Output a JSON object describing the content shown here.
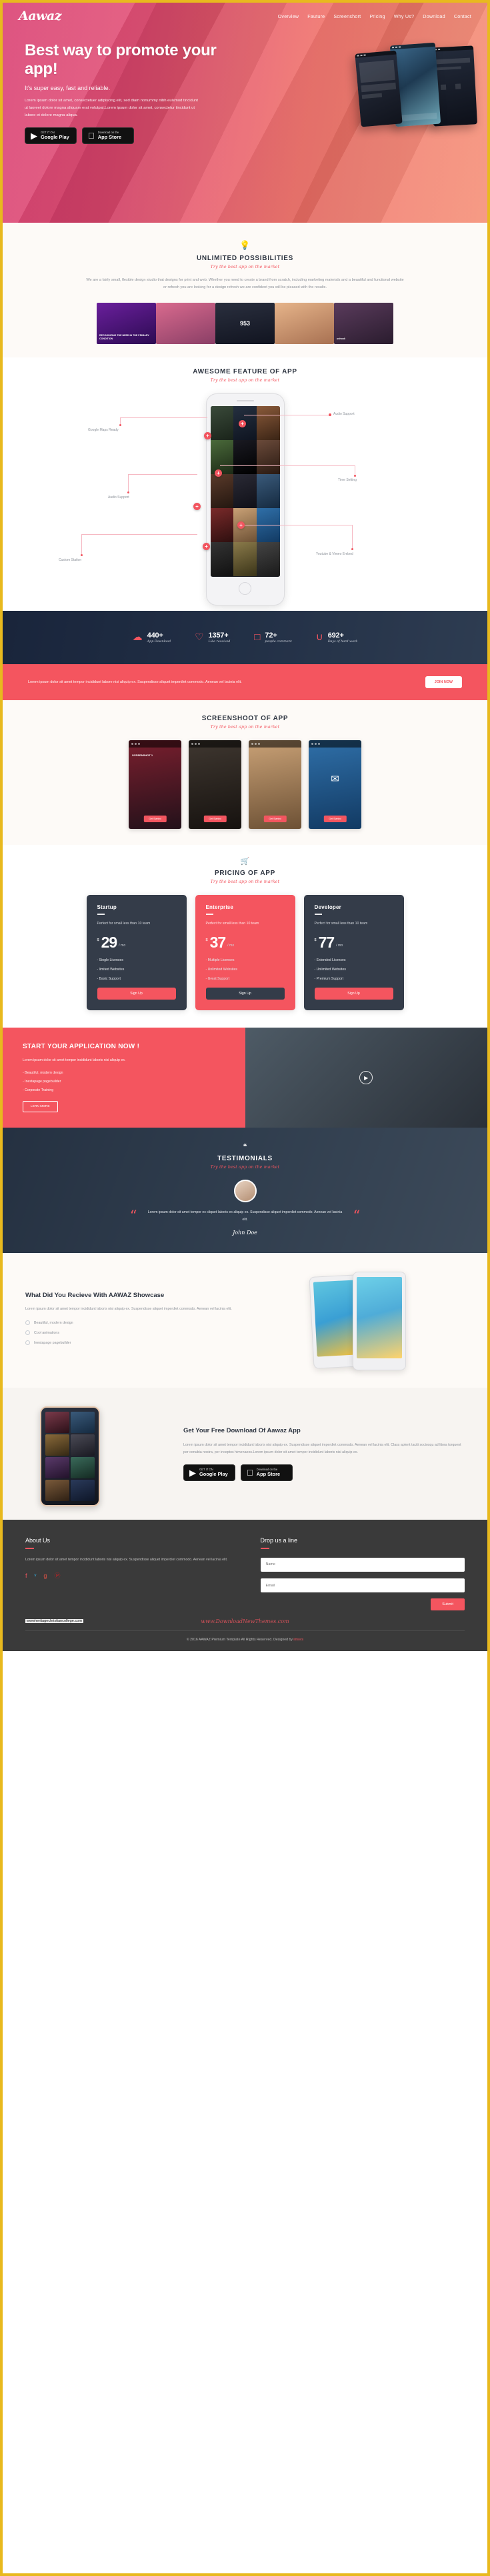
{
  "brand": {
    "logo": "Aawaz",
    "accent": "#f4555f",
    "dark": "#343c49",
    "border": "#e8b91e"
  },
  "nav": {
    "items": [
      {
        "label": "Overview"
      },
      {
        "label": "Fauture"
      },
      {
        "label": "Screenshort"
      },
      {
        "label": "Pricing"
      },
      {
        "label": "Why Us?"
      },
      {
        "label": "Download"
      },
      {
        "label": "Contact"
      }
    ]
  },
  "hero": {
    "heading": "Best way to promote your app!",
    "subheading": "It's super easy, fast and reliable.",
    "lead": "Lorem ipsum dolor sit amet, consectetuer adipiscing elit, sed diam nonummy nibh euismod tincidunt ut laoreet dolore magna aliquam erat volutpat.Lorem ipsum dolor sit amet, consectetur tincidunt ut labore et dolore magna aliqua.",
    "stores": [
      {
        "icon": "google-play-icon",
        "glyph": "▶",
        "small": "GET IT ON",
        "big": "Google Play"
      },
      {
        "icon": "apple-icon",
        "glyph": "",
        "small": "Download on the",
        "big": "App Store"
      }
    ]
  },
  "unlimited": {
    "icon": "lightbulb-icon",
    "glyph": "💡",
    "title": "UNLIMITED POSSIBILITIES",
    "subtitle": "Try the best app on the market",
    "body": "We are a fairly small, flexible design studio that designs for print and web. Whether you need to create a brand from scratch, including marketing materials and a beautiful and functional website or refresh you are looking for a design refresh we are confident you will be pleased with the results.",
    "showcase": [
      {
        "caption": "RECOGNIZING THE NEED IN THE PRIMARY CONDITION",
        "color1": "#6a1f9c",
        "color2": "#2c0b52"
      },
      {
        "caption": "",
        "color1": "#d96a8e",
        "color2": "#8a3f66"
      },
      {
        "caption": "953",
        "color1": "#2a2f3e",
        "color2": "#111420"
      },
      {
        "caption": "",
        "color1": "#e6b48a",
        "color2": "#a87152"
      },
      {
        "caption": "unhook",
        "color1": "#5a3b5c",
        "color2": "#2a1c2e"
      }
    ]
  },
  "feature": {
    "title": "AWESOME FEATURE OF APP",
    "subtitle": "Try the best app on the market",
    "labels_left": [
      {
        "label": "Google Maps Ready"
      },
      {
        "label": "Audio Support"
      },
      {
        "label": "Custom Station"
      }
    ],
    "labels_right": [
      {
        "label": "Audio Support"
      },
      {
        "label": "Time Setting"
      },
      {
        "label": "Youtube & Vimeo Embed"
      }
    ],
    "marker": "+"
  },
  "counters": [
    {
      "icon": "cloud-download-icon",
      "glyph": "☁",
      "number": "440+",
      "label": "App Download"
    },
    {
      "icon": "heart-icon",
      "glyph": "♡",
      "number": "1357+",
      "label": "Like received"
    },
    {
      "icon": "comment-icon",
      "glyph": "□",
      "number": "72+",
      "label": "people comment"
    },
    {
      "icon": "coffee-icon",
      "glyph": "∪",
      "number": "692+",
      "label": "Days of hard work"
    }
  ],
  "band": {
    "text": "Lorem ipsum dolor sit amet tempor incididunt labore nisi aliquip ex. Suspendisse aliquet imperdiet commodo. Aenean vel lacinia elit.",
    "button": "JOIN NOW"
  },
  "screenshot": {
    "title": "SCREENSHOOT OF APP",
    "subtitle": "Try the best app on the market",
    "items": [
      {
        "label": "SCREENSHOT 1",
        "button": "Get Started",
        "c1": "#7a1f2e",
        "c2": "#23111a"
      },
      {
        "label": "",
        "button": "Get Started",
        "c1": "#3f3730",
        "c2": "#16120f"
      },
      {
        "label": "",
        "button": "Get Started",
        "c1": "#c9a176",
        "c2": "#6d5135"
      },
      {
        "label": "",
        "button": "Get Started",
        "c1": "#2f6fa8",
        "c2": "#123a63"
      }
    ]
  },
  "pricing": {
    "icon": "cart-icon",
    "glyph": "🛒",
    "title": "PRICING OF APP",
    "subtitle": "Try the best app on the market",
    "plans": [
      {
        "name": "Startup",
        "desc": "Perfect for small less than 10 team",
        "currency": "$",
        "amount": "29",
        "period": "/ mo",
        "features": [
          "- Single Licenses",
          "- limited Websites",
          "- Basic Support"
        ],
        "cta": "Sign Up",
        "highlight": false
      },
      {
        "name": "Enterprise",
        "desc": "Perfect for small less than 10 team",
        "currency": "$",
        "amount": "37",
        "period": "/ mo",
        "features": [
          "- Multiple Licenses",
          "- Unlimited Websites",
          "- Great Support"
        ],
        "cta": "Sign Up",
        "highlight": true
      },
      {
        "name": "Developer",
        "desc": "Perfect for small less than 10 team",
        "currency": "$",
        "amount": "77",
        "period": "/ mo",
        "features": [
          "- Extended Licenses",
          "- Unlimited Websites",
          "- Premium Support"
        ],
        "cta": "Sign Up",
        "highlight": false
      }
    ]
  },
  "start": {
    "heading": "START YOUR APPLICATION NOW !",
    "text": "Lorem ipsum dolor sit amet tempor incididunt laboris nisi aliquip ex.",
    "features": [
      "- Beautiful, modern design",
      "- Inestapage pagebuilder",
      "- Corporate Training"
    ],
    "button": "LERN MORE",
    "play_icon": "play-icon"
  },
  "testimonials": {
    "icon": "quote-icon",
    "glyph": "❝",
    "title": "TESTIMONIALS",
    "subtitle": "Try the best app on the market",
    "quote": "Lorem ipsum dolor sit amet tempor ex cliquet laboris ex aliquip ex. Suspendisse aliquet imperdiet commodo. Aenean vel lacinia elit.",
    "author": "John Doe",
    "quote_mark": "“"
  },
  "receive": {
    "heading": "What Did You Recieve With AAWAZ Showcase",
    "text": "Lorem ipsum dolor sit amet tempor incididunt laboris nisi aliquip ex. Suspendisse aliquet imperdiet commodo. Aenean vel lacinia elit.",
    "features": [
      {
        "label": "Beautiful, modern design"
      },
      {
        "label": "Cool animations"
      },
      {
        "label": "Inestapage pagebuilder"
      }
    ]
  },
  "free_download": {
    "heading": "Get Your Free Download Of Aawaz App",
    "text": "Lorem ipsum dolor sit amet tempor incididunt laboris nisi aliquip ex. Suspendisse aliquet imperdiet commodo. Aenean vel lacinia elit. Class aptent taciti sociosqu ad litora torquent per conubia nostra, per inceptos himenaeos.Lorem ipsum dolor sit amet tempor incididunt laboris nisi aliquip ex.",
    "stores": [
      {
        "icon": "google-play-icon",
        "glyph": "▶",
        "small": "GET IT ON",
        "big": "Google Play"
      },
      {
        "icon": "apple-icon",
        "glyph": "",
        "small": "Download on the",
        "big": "App Store"
      }
    ]
  },
  "footer": {
    "about_title": "About Us",
    "about_text": "Lorem ipsum dolor sit amet tempor incididunt laboris nisi aliquip ex. Suspendisse aliquet imperdiet commodo. Aenean vel lacinia elit.",
    "social": [
      {
        "icon": "facebook-icon",
        "glyph": "f"
      },
      {
        "icon": "twitter-icon",
        "glyph": "ᵛ"
      },
      {
        "icon": "google-plus-icon",
        "glyph": "g"
      },
      {
        "icon": "pinterest-icon",
        "glyph": "Ⓟ"
      }
    ],
    "site_url": "wwwheritagechristiancollege.com",
    "watermark": "www.DownloadNewThemes.com",
    "contact_title": "Drop us a line",
    "name_placeholder": "Name",
    "email_placeholder": "Email",
    "submit": "Submit",
    "copyright_pre": "© 2016 AAWAZ Premium Template All Rights Reserved. Designed by ",
    "copyright_link": "iimovs"
  }
}
